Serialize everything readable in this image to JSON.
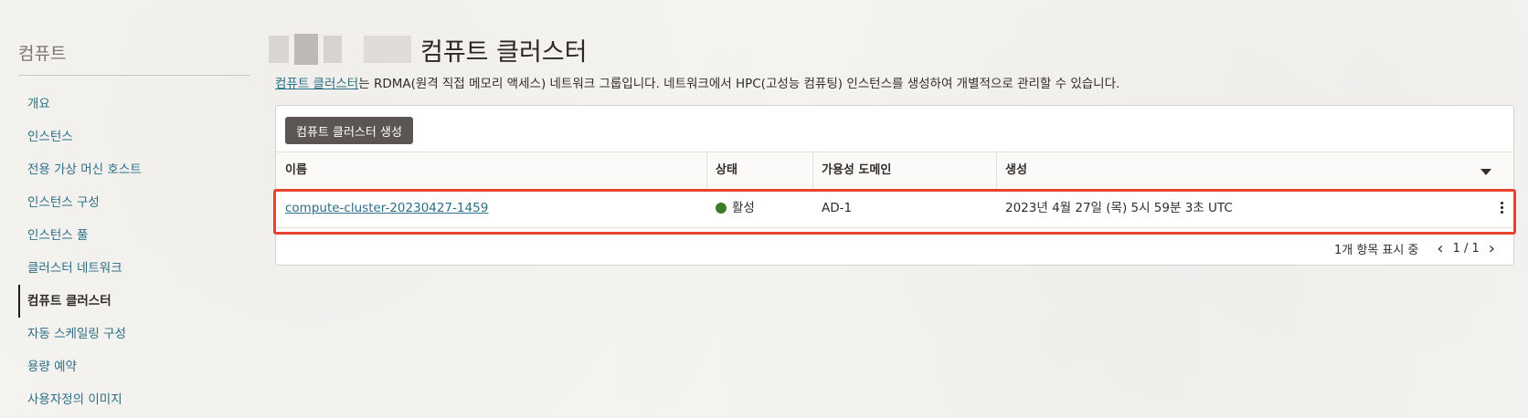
{
  "sidebar": {
    "title": "컴퓨트",
    "items": [
      {
        "label": "개요"
      },
      {
        "label": "인스턴스"
      },
      {
        "label": "전용 가상 머신 호스트"
      },
      {
        "label": "인스턴스 구성"
      },
      {
        "label": "인스턴스 풀"
      },
      {
        "label": "클러스터 네트워크"
      },
      {
        "label": "컴퓨트 클러스터"
      },
      {
        "label": "자동 스케일링 구성"
      },
      {
        "label": "용량 예약"
      },
      {
        "label": "사용자정의 이미지"
      }
    ],
    "active_index": 6
  },
  "page": {
    "title": "컴퓨트 클러스터",
    "description_link": "컴퓨트 클러스터",
    "description_rest": "는 RDMA(원격 직접 메모리 액세스) 네트워크 그룹입니다. 네트워크에서 HPC(고성능 컴퓨팅) 인스턴스를 생성하여 개별적으로 관리할 수 있습니다."
  },
  "toolbar": {
    "create_label": "컴퓨트 클러스터 생성"
  },
  "table": {
    "headers": [
      "이름",
      "상태",
      "가용성 도메인",
      "생성"
    ],
    "rows": [
      {
        "name": "compute-cluster-20230427-1459",
        "status": "활성",
        "availability_domain": "AD-1",
        "created": "2023년 4월 27일 (목) 5시 59분 3초 UTC"
      }
    ]
  },
  "pagination": {
    "count_label": "1개 항목 표시 중",
    "page_label": "1 / 1"
  },
  "colors": {
    "link": "#2b6f86",
    "status_active": "#3f7a26",
    "highlight": "#e8432e",
    "button": "#5b5653"
  }
}
